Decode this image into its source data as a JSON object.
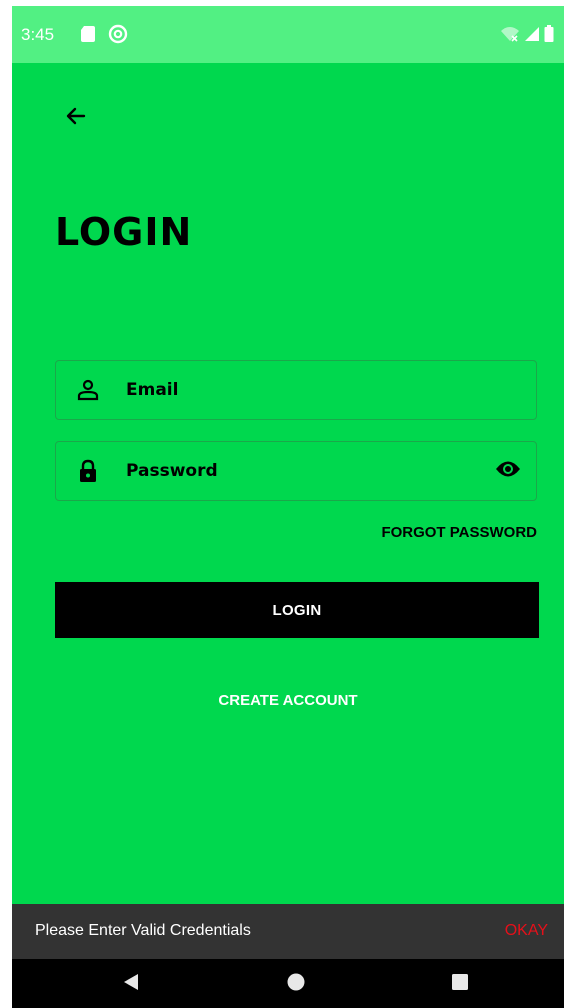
{
  "status_bar": {
    "time": "3:45",
    "icons": [
      "sd-card-icon",
      "at-sign-icon",
      "wifi-off-icon",
      "signal-icon",
      "battery-icon"
    ]
  },
  "header": {
    "back_icon": "arrow-left-icon",
    "title": "LOGIN"
  },
  "form": {
    "email": {
      "placeholder": "Email",
      "value": "",
      "icon": "person-icon"
    },
    "password": {
      "placeholder": "Password",
      "value": "",
      "icon": "lock-icon",
      "toggle_icon": "eye-icon"
    },
    "forgot_label": "FORGOT PASSWORD",
    "login_label": "LOGIN",
    "create_account_label": "CREATE ACCOUNT"
  },
  "snackbar": {
    "message": "Please Enter Valid Credentials",
    "action": "OKAY"
  },
  "nav": {
    "icons": [
      "back-triangle-icon",
      "home-circle-icon",
      "recents-square-icon"
    ]
  },
  "colors": {
    "background": "#00d84e",
    "status_bar": "#52f083",
    "button": "#000000",
    "snackbar_bg": "#333333",
    "snackbar_action": "#e5101a"
  }
}
